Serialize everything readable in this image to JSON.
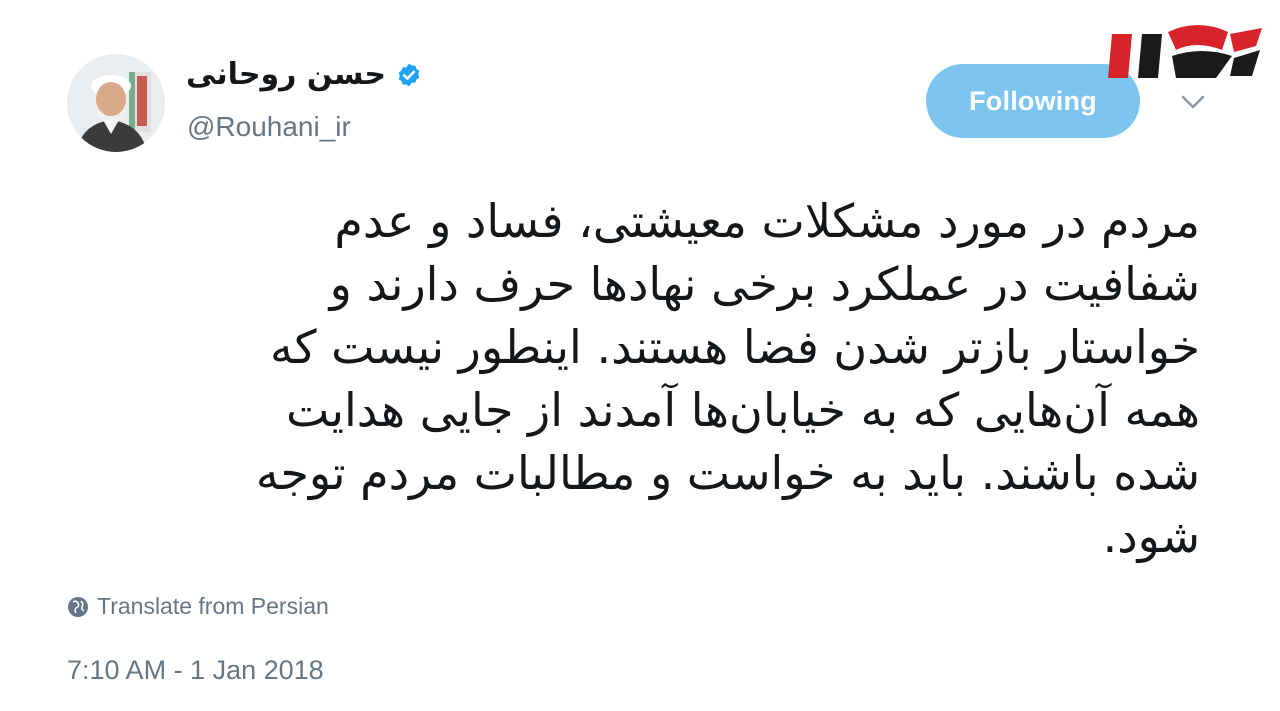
{
  "tweet": {
    "author": {
      "display_name": "حسن روحانی",
      "handle": "@Rouhani_ir",
      "verified": true
    },
    "follow_button_label": "Following",
    "text": "مردم در مورد مشکلات معیشتی، فساد و عدم\nشفافیت در عملکرد برخی نهادها حرف دارند و\nخواستار بازتر شدن فضا هستند. اینطور نیست که\nهمه آن‌هایی که به خیابان‌ها آمدند از جایی هدایت\nشده باشند. باید به خواست و مطالبات مردم توجه\nشود.",
    "translate_label": "Translate from Persian",
    "timestamp": "7:10 AM - 1 Jan 2018"
  },
  "icons": {
    "verified": "verified-badge-icon",
    "caret": "chevron-down-icon",
    "globe": "globe-icon"
  },
  "colors": {
    "accent": "#1da1f2",
    "follow_button": "#7dc5ee",
    "text": "#14171a",
    "secondary_text": "#657786",
    "brand_red": "#d8232a"
  }
}
